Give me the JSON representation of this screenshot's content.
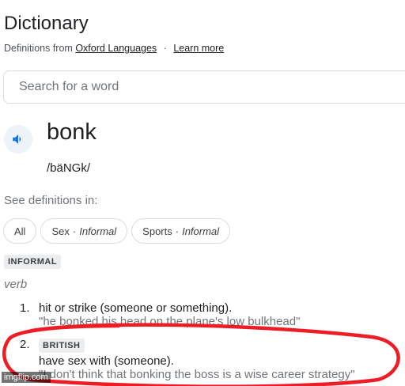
{
  "header": {
    "title": "Dictionary",
    "attribution_prefix": "Definitions from",
    "source_link": "Oxford Languages",
    "separator": "·",
    "learn_more": "Learn more"
  },
  "search": {
    "placeholder": "Search for a word"
  },
  "entry": {
    "word": "bonk",
    "phonetic": "/bäNGk/",
    "speaker_icon": "volume-icon",
    "see_definitions_label": "See definitions in:",
    "chips": [
      {
        "label": "All",
        "sub": ""
      },
      {
        "label": "Sex",
        "sub": "Informal"
      },
      {
        "label": "Sports",
        "sub": "Informal"
      }
    ],
    "chip_separator": "·",
    "register_label": "INFORMAL",
    "part_of_speech": "verb",
    "definitions": [
      {
        "number": "1.",
        "text": "hit or strike (someone or something).",
        "example": "\"he bonked his head on the plane's low bulkhead\""
      },
      {
        "number": "2.",
        "label": "BRITISH",
        "text": "have sex with (someone).",
        "example": "\"I don't think that bonking the boss is a wise career strategy\""
      }
    ]
  },
  "annotation": {
    "color": "#ee1c24"
  },
  "watermark": "imgflip.com",
  "colors": {
    "accent_blue": "#1a73e8",
    "speaker_bg": "#eef2f9",
    "muted_text": "#70757a"
  }
}
